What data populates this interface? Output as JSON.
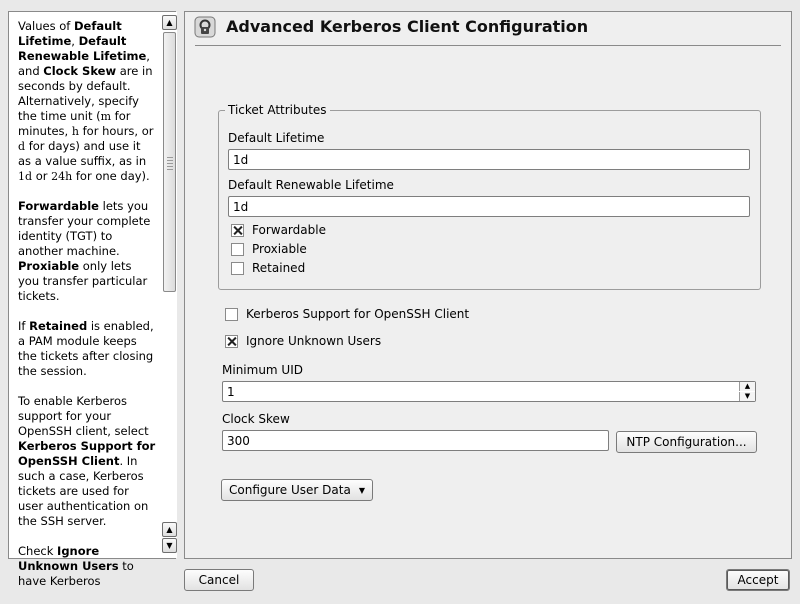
{
  "help": {
    "paragraphs": [
      [
        {
          "t": "Values of "
        },
        {
          "t": "Default Lifetime",
          "b": true
        },
        {
          "t": ", "
        },
        {
          "t": "Default Renewable Lifetime",
          "b": true
        },
        {
          "t": ", and "
        },
        {
          "t": "Clock Skew",
          "b": true
        },
        {
          "t": " are in seconds by default. Alternatively, specify the time unit ("
        },
        {
          "t": "m",
          "m": true
        },
        {
          "t": " for minutes, "
        },
        {
          "t": "h",
          "m": true
        },
        {
          "t": " for hours, or "
        },
        {
          "t": "d",
          "m": true
        },
        {
          "t": " for days) and use it as a value suffix, as in "
        },
        {
          "t": "1d",
          "m": true
        },
        {
          "t": " or "
        },
        {
          "t": "24h",
          "m": true
        },
        {
          "t": " for one day)."
        }
      ],
      [
        {
          "t": "Forwardable",
          "b": true
        },
        {
          "t": " lets you transfer your complete identity (TGT) to another machine. "
        },
        {
          "t": "Proxiable",
          "b": true
        },
        {
          "t": " only lets you transfer particular tickets."
        }
      ],
      [
        {
          "t": "If "
        },
        {
          "t": "Retained",
          "b": true
        },
        {
          "t": " is enabled, a PAM module keeps the tickets after closing the session."
        }
      ],
      [
        {
          "t": "To enable Kerberos support for your OpenSSH client, select "
        },
        {
          "t": "Kerberos Support for OpenSSH Client",
          "b": true
        },
        {
          "t": ". In such a case, Kerberos tickets are used for user authentication on the SSH server."
        }
      ],
      [
        {
          "t": "Check "
        },
        {
          "t": "Ignore Unknown Users",
          "b": true
        },
        {
          "t": " to have Kerberos"
        }
      ]
    ]
  },
  "main": {
    "title": "Advanced Kerberos Client Configuration",
    "ticket_group": {
      "legend": "Ticket Attributes",
      "default_lifetime_label": "Default Lifetime",
      "default_lifetime_value": "1d",
      "renewable_lifetime_label": "Default Renewable Lifetime",
      "renewable_lifetime_value": "1d",
      "forwardable": {
        "label": "Forwardable",
        "checked": true
      },
      "proxiable": {
        "label": "Proxiable",
        "checked": false
      },
      "retained": {
        "label": "Retained",
        "checked": false
      }
    },
    "openssh_support": {
      "label": "Kerberos Support for OpenSSH Client",
      "checked": false
    },
    "ignore_unknown_users": {
      "label": "Ignore Unknown Users",
      "checked": true
    },
    "minimum_uid_label": "Minimum UID",
    "minimum_uid_value": "1",
    "clock_skew_label": "Clock Skew",
    "clock_skew_value": "300",
    "ntp_button": "NTP Configuration...",
    "configure_user_data_button": "Configure User Data"
  },
  "footer": {
    "cancel": "Cancel",
    "accept": "Accept"
  },
  "icons": {
    "title_icon": "lock-key-icon",
    "scroll_up": "arrow-up-icon",
    "scroll_down": "arrow-down-icon",
    "dropdown": "triangle-down-icon"
  }
}
